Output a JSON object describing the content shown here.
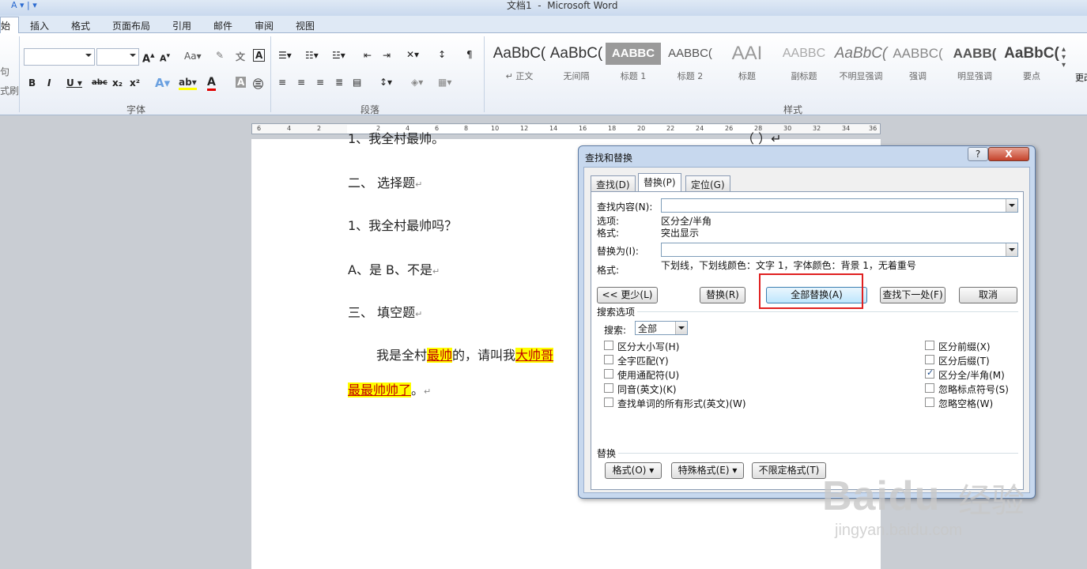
{
  "window": {
    "title": "文档1  -  Microsoft Word"
  },
  "ribbon_tabs": [
    "始",
    "插入",
    "格式",
    "页面布局",
    "引用",
    "邮件",
    "审阅",
    "视图"
  ],
  "ribbon": {
    "left_labels": [
      "句",
      "式刷"
    ],
    "groups": [
      "字体",
      "段落",
      "样式"
    ],
    "more_label": "更改",
    "styles": [
      {
        "sample": "AaBbC(",
        "caption": "↵ 正文"
      },
      {
        "sample": "AaBbC(",
        "caption": "无间隔"
      },
      {
        "sample": "AABBC",
        "caption": "标题 1"
      },
      {
        "sample": "AABBC(",
        "caption": "标题 2"
      },
      {
        "sample": "AAI",
        "caption": "标题"
      },
      {
        "sample": "AABBC",
        "caption": "副标题"
      },
      {
        "sample": "AaBbC(",
        "caption": "不明显强调"
      },
      {
        "sample": "AABBC(",
        "caption": "强调"
      },
      {
        "sample": "AABB(",
        "caption": "明显强调"
      },
      {
        "sample": "AaBbC(",
        "caption": "要点"
      }
    ]
  },
  "ruler_ticks": [
    "6",
    "4",
    "2",
    "2",
    "4",
    "6",
    "8",
    "10",
    "12",
    "14",
    "16",
    "18",
    "20",
    "22",
    "24",
    "26",
    "28",
    "30",
    "32",
    "34",
    "36"
  ],
  "document": {
    "line0": "1、我全村最帅。",
    "line0_tail": "（  ）↵",
    "heading2": "二、  选择题",
    "q1": "1、我全村最帅吗？",
    "options": "A、是        B、不是",
    "heading3": "三、  填空题",
    "fill_a": "我是全村",
    "fill_b": "最帅",
    "fill_c": "的，请叫我",
    "fill_d": "大帅哥",
    "fill_e": "最最帅帅了",
    "fill_f": "。",
    "para_mark": "↵"
  },
  "dialog": {
    "title": "查找和替换",
    "help": "?",
    "close": "X",
    "tabs": [
      "查找(D)",
      "替换(P)",
      "定位(G)"
    ],
    "find_label": "查找内容(N):",
    "find_value": "",
    "options_label": "选项:",
    "options_value": "区分全/半角",
    "format_label": "格式:",
    "format_value": "突出显示",
    "replace_label": "替换为(I):",
    "replace_value": "",
    "replace_format_label": "格式:",
    "replace_format_value": "下划线，下划线颜色：文字 1，字体颜色：背景 1，无着重号",
    "buttons": {
      "less": "<< 更少(L)",
      "replace": "替换(R)",
      "replace_all": "全部替换(A)",
      "find_next": "查找下一处(F)",
      "cancel": "取消"
    },
    "search_options_label": "搜索选项",
    "search_label": "搜索:",
    "search_value": "全部",
    "left_checks": [
      {
        "label": "区分大小写(H)",
        "checked": false
      },
      {
        "label": "全字匹配(Y)",
        "checked": false
      },
      {
        "label": "使用通配符(U)",
        "checked": false
      },
      {
        "label": "同音(英文)(K)",
        "checked": false
      },
      {
        "label": "查找单词的所有形式(英文)(W)",
        "checked": false
      }
    ],
    "right_checks": [
      {
        "label": "区分前缀(X)",
        "checked": false
      },
      {
        "label": "区分后缀(T)",
        "checked": false
      },
      {
        "label": "区分全/半角(M)",
        "checked": true
      },
      {
        "label": "忽略标点符号(S)",
        "checked": false
      },
      {
        "label": "忽略空格(W)",
        "checked": false
      }
    ],
    "replace_section_label": "替换",
    "bottom_buttons": {
      "format": "格式(O) ▾",
      "special": "特殊格式(E) ▾",
      "no_format": "不限定格式(T)"
    }
  },
  "watermark": {
    "brand": "Baidu",
    "cn": "经验",
    "url": "jingyan.baidu.com"
  },
  "colors": {
    "highlight": "#ffff00",
    "highlight_text": "#c00000",
    "annotation": "#e02020"
  }
}
